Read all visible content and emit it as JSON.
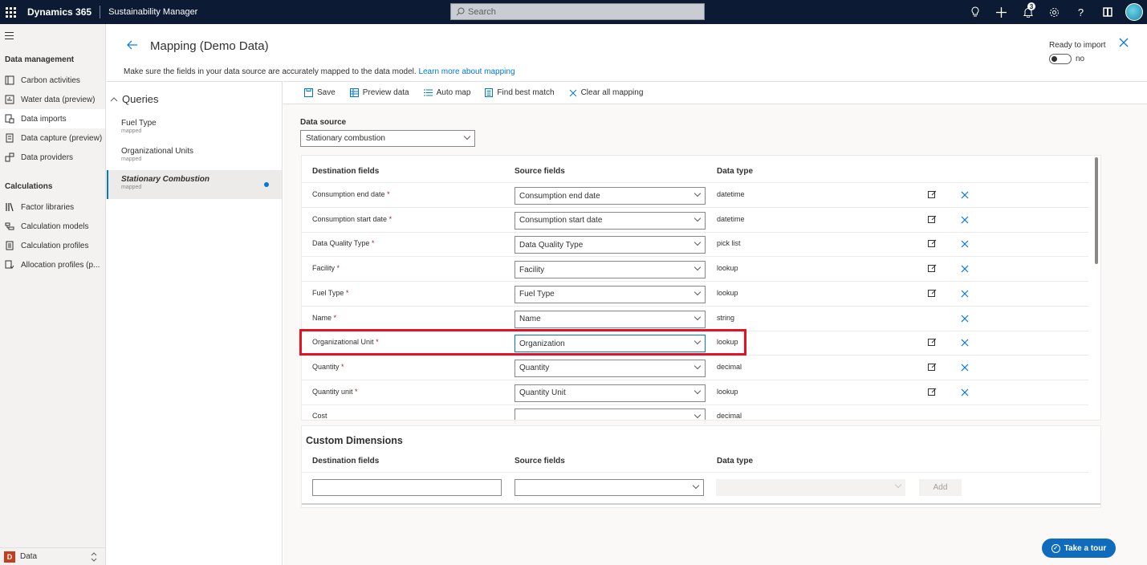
{
  "topbar": {
    "brand": "Dynamics 365",
    "app_name": "Sustainability Manager",
    "search_placeholder": "Search",
    "notification_count": "3"
  },
  "leftnav": {
    "section_data": "Data management",
    "data_items": [
      {
        "label": "Carbon activities"
      },
      {
        "label": "Water data (preview)"
      },
      {
        "label": "Data imports"
      },
      {
        "label": "Data capture (preview)"
      },
      {
        "label": "Data providers"
      }
    ],
    "section_calc": "Calculations",
    "calc_items": [
      {
        "label": "Factor libraries"
      },
      {
        "label": "Calculation models"
      },
      {
        "label": "Calculation profiles"
      },
      {
        "label": "Allocation profiles (p..."
      }
    ],
    "area_badge": "D",
    "area_label": "Data"
  },
  "header": {
    "title": "Mapping (Demo Data)",
    "subtitle": "Make sure the fields in your data source are accurately mapped to the data model.",
    "link": "Learn more about mapping",
    "ready_label": "Ready to import",
    "toggle_value": "no"
  },
  "queries": {
    "heading": "Queries",
    "items": [
      {
        "name": "Fuel Type",
        "status": "mapped"
      },
      {
        "name": "Organizational Units",
        "status": "mapped"
      },
      {
        "name": "Stationary Combustion",
        "status": "mapped"
      }
    ]
  },
  "toolbar": {
    "save": "Save",
    "preview": "Preview data",
    "automap": "Auto map",
    "bestmatch": "Find best match",
    "clear": "Clear all mapping"
  },
  "datasource": {
    "label": "Data source",
    "value": "Stationary combustion"
  },
  "mapping": {
    "headers": {
      "dest": "Destination fields",
      "src": "Source fields",
      "type": "Data type"
    },
    "rows": [
      {
        "dest": "Consumption end date",
        "req": "*",
        "src": "Consumption end date",
        "type": "datetime"
      },
      {
        "dest": "Consumption start date",
        "req": "*",
        "src": "Consumption start date",
        "type": "datetime"
      },
      {
        "dest": "Data Quality Type",
        "req": "*",
        "src": "Data Quality Type",
        "type": "pick list"
      },
      {
        "dest": "Facility",
        "req": "*",
        "src": "Facility",
        "type": "lookup"
      },
      {
        "dest": "Fuel Type",
        "req": "*",
        "src": "Fuel Type",
        "type": "lookup"
      },
      {
        "dest": "Name",
        "req": "*",
        "src": "Name",
        "type": "string"
      },
      {
        "dest": "Organizational Unit",
        "req": "*",
        "src": "Organization",
        "type": "lookup"
      },
      {
        "dest": "Quantity",
        "req": "*",
        "src": "Quantity",
        "type": "decimal"
      },
      {
        "dest": "Quantity unit",
        "req": "*",
        "src": "Quantity Unit",
        "type": "lookup"
      },
      {
        "dest": "Cost",
        "req": "",
        "src": "",
        "type": "decimal"
      }
    ]
  },
  "custom": {
    "title": "Custom Dimensions",
    "headers": {
      "dest": "Destination fields",
      "src": "Source fields",
      "type": "Data type"
    },
    "add": "Add"
  },
  "tour": {
    "label": "Take a tour"
  }
}
